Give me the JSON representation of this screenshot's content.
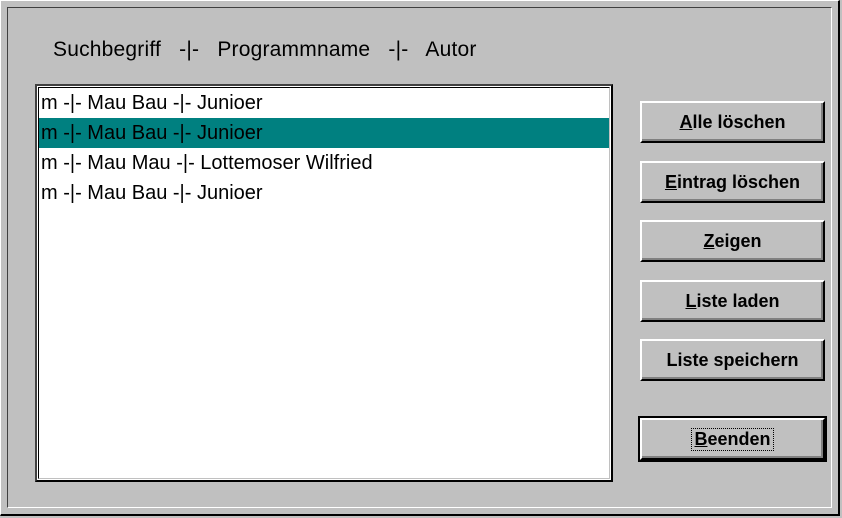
{
  "header": {
    "col1": "Suchbegriff",
    "sep1": "-|-",
    "col2": "Programmname",
    "sep2": "-|-",
    "col3": "Autor"
  },
  "list": {
    "items": [
      "m -|- Mau Bau -|- Junioer",
      "m -|- Mau Bau -|- Junioer",
      "m -|- Mau Mau -|- Lottemoser Wilfried",
      "m -|- Mau Bau -|- Junioer"
    ],
    "selected_index": 1
  },
  "buttons": {
    "clear_all": {
      "mnemonic": "A",
      "rest": "lle löschen"
    },
    "delete_entry": {
      "mnemonic": "E",
      "rest": "intrag löschen"
    },
    "show": {
      "mnemonic": "Z",
      "rest": "eigen"
    },
    "load_list": {
      "mnemonic": "L",
      "rest": "iste laden"
    },
    "save_list": {
      "mnemonic": "",
      "rest": "Liste speichern"
    },
    "exit": {
      "mnemonic": "B",
      "rest": "eenden"
    }
  },
  "colors": {
    "window_bg": "#c0c0c0",
    "selection": "#008080"
  }
}
